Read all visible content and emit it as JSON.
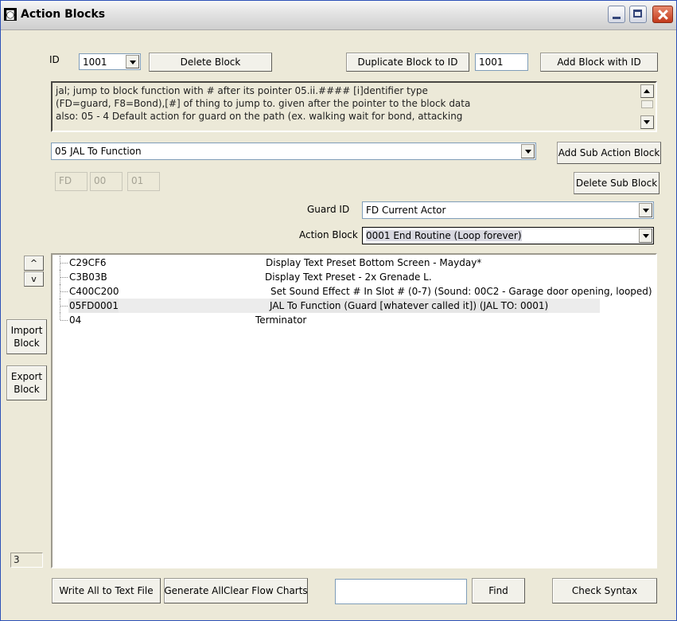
{
  "window": {
    "title": "Action Blocks"
  },
  "top": {
    "id_label": "ID",
    "id_value": "1001",
    "delete_block": "Delete Block",
    "duplicate_block": "Duplicate Block to ID",
    "duplicate_id_value": "1001",
    "add_block": "Add Block with ID"
  },
  "description": {
    "lines": [
      "jal; jump to block function with # after its pointer 05.ii.#### [i]dentifier type",
      "(FD=guard, F8=Bond),[#] of thing to jump to.  given after the pointer to the block data",
      "also: 05 - 4 Default action for guard on the path (ex. walking wait for bond, attacking"
    ]
  },
  "sub_action": {
    "selected": "05 JAL To Function",
    "add_button": "Add Sub Action Block",
    "delete_button": "Delete Sub Block",
    "params": [
      "FD",
      "00",
      "01"
    ]
  },
  "guard": {
    "label": "Guard ID",
    "value": "FD Current Actor"
  },
  "action_block": {
    "label": "Action Block",
    "value": "0001 End Routine (Loop forever)"
  },
  "move": {
    "up": "^",
    "down": "v"
  },
  "side": {
    "import": "Import Block",
    "export": "Export Block",
    "count": "3"
  },
  "tree": {
    "rows": [
      {
        "code": "C29CF6",
        "desc": "Display Text Preset Bottom Screen - Mayday*"
      },
      {
        "code": "C3B03B",
        "desc": "Display Text Preset - 2x Grenade L."
      },
      {
        "code": "C400C200",
        "desc": "Set Sound Effect # In Slot # (0-7) (Sound: 00C2 - Garage door opening, looped)"
      },
      {
        "code": "05FD0001",
        "desc": "JAL To Function (Guard [whatever called it]) (JAL TO: 0001)"
      },
      {
        "code": "04",
        "desc": "Terminator"
      }
    ]
  },
  "bottom": {
    "write_all": "Write All to Text File",
    "generate": "Generate AllClear Flow Charts",
    "find_value": "",
    "find": "Find",
    "check_syntax": "Check Syntax"
  },
  "colors": {
    "title_bar": "#e2e2e2",
    "window_bg": "#ece9d8",
    "close_button": "#c2391b",
    "selected_row": "#ececec"
  }
}
